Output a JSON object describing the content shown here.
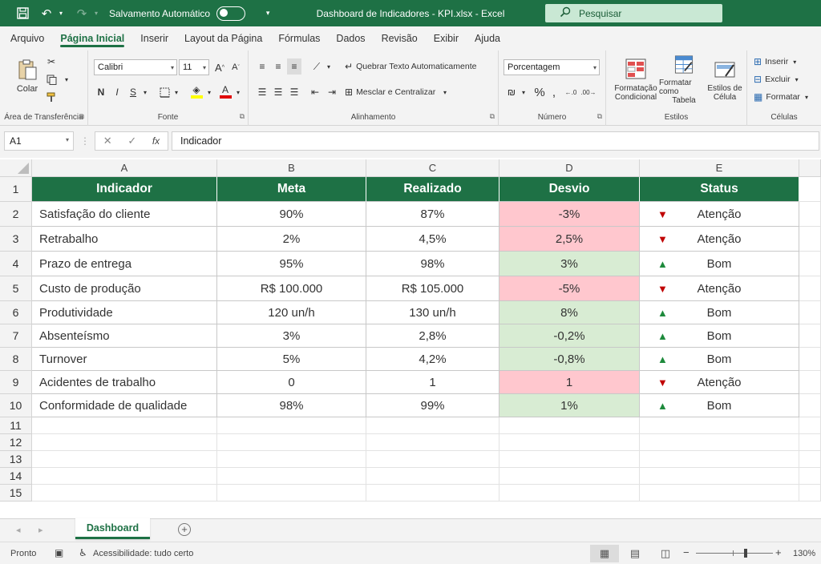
{
  "window": {
    "autosave_label": "Salvamento Automático",
    "title": "Dashboard de Indicadores - KPI.xlsx  -  Excel",
    "search_placeholder": "Pesquisar"
  },
  "menu": {
    "tabs": [
      "Arquivo",
      "Página Inicial",
      "Inserir",
      "Layout da Página",
      "Fórmulas",
      "Dados",
      "Revisão",
      "Exibir",
      "Ajuda"
    ],
    "active_tab": "Página Inicial"
  },
  "ribbon": {
    "clipboard": {
      "label": "Área de Transferência",
      "paste": "Colar"
    },
    "font": {
      "label": "Fonte",
      "family": "Calibri",
      "size": "11"
    },
    "alignment": {
      "label": "Alinhamento",
      "wrap": "Quebrar Texto Automaticamente",
      "merge": "Mesclar e Centralizar"
    },
    "number": {
      "label": "Número",
      "format": "Porcentagem"
    },
    "styles": {
      "label": "Estilos",
      "conditional_1": "Formatação",
      "conditional_2": "Condicional",
      "table_1": "Formatar como",
      "table_2": "Tabela",
      "cell_1": "Estilos de",
      "cell_2": "Célula"
    },
    "cells": {
      "label": "Células",
      "insert": "Inserir",
      "delete": "Excluir",
      "format": "Formatar"
    }
  },
  "formula_bar": {
    "name_box": "A1",
    "fx": "fx",
    "content": "Indicador"
  },
  "sheet": {
    "columns": [
      "A",
      "B",
      "C",
      "D",
      "E"
    ],
    "row_numbers": [
      "1",
      "2",
      "3",
      "4",
      "5",
      "6",
      "7",
      "8",
      "9",
      "10",
      "11",
      "12",
      "13",
      "14",
      "15"
    ],
    "header": [
      "Indicador",
      "Meta",
      "Realizado",
      "Desvio",
      "Status"
    ],
    "rows": [
      {
        "indicador": "Satisfação do cliente",
        "meta": "90%",
        "realizado": "87%",
        "desvio": "-3%",
        "desvio_state": "red",
        "status_icon": "down",
        "status": "Atenção"
      },
      {
        "indicador": "Retrabalho",
        "meta": "2%",
        "realizado": "4,5%",
        "desvio": "2,5%",
        "desvio_state": "red",
        "status_icon": "down",
        "status": "Atenção"
      },
      {
        "indicador": "Prazo de entrega",
        "meta": "95%",
        "realizado": "98%",
        "desvio": "3%",
        "desvio_state": "green",
        "status_icon": "up",
        "status": "Bom"
      },
      {
        "indicador": "Custo de produção",
        "meta": "R$ 100.000",
        "realizado": "R$ 105.000",
        "desvio": "-5%",
        "desvio_state": "red",
        "status_icon": "down",
        "status": "Atenção"
      },
      {
        "indicador": "Produtividade",
        "meta": "120 un/h",
        "realizado": "130 un/h",
        "desvio": "8%",
        "desvio_state": "green",
        "status_icon": "up",
        "status": "Bom"
      },
      {
        "indicador": "Absenteísmo",
        "meta": "3%",
        "realizado": "2,8%",
        "desvio": "-0,2%",
        "desvio_state": "green",
        "status_icon": "up",
        "status": "Bom"
      },
      {
        "indicador": "Turnover",
        "meta": "5%",
        "realizado": "4,2%",
        "desvio": "-0,8%",
        "desvio_state": "green",
        "status_icon": "up",
        "status": "Bom"
      },
      {
        "indicador": "Acidentes de trabalho",
        "meta": "0",
        "realizado": "1",
        "desvio": "1",
        "desvio_state": "red",
        "status_icon": "down",
        "status": "Atenção"
      },
      {
        "indicador": "Conformidade de qualidade",
        "meta": "98%",
        "realizado": "99%",
        "desvio": "1%",
        "desvio_state": "green",
        "status_icon": "up",
        "status": "Bom"
      }
    ],
    "tab_name": "Dashboard"
  },
  "statusbar": {
    "ready": "Pronto",
    "accessibility": "Acessibilidade: tudo certo",
    "zoom": "130%"
  },
  "colors": {
    "brand_green": "#1e7145",
    "bad_fill": "#ffc7ce",
    "good_fill": "#d8ecd3",
    "icon_down": "#c00000",
    "icon_up": "#1e8a3c"
  }
}
